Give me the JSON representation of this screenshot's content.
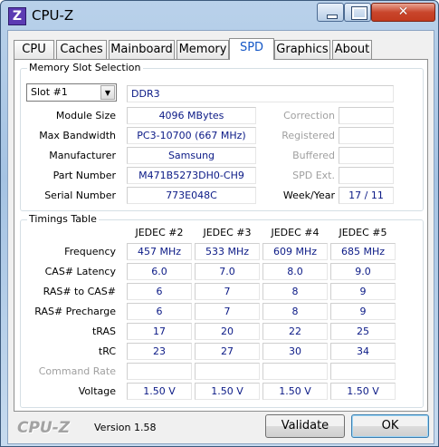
{
  "window": {
    "title": "CPU-Z",
    "app_icon_letter": "Z",
    "close_glyph": "✕"
  },
  "tabs": [
    "CPU",
    "Caches",
    "Mainboard",
    "Memory",
    "SPD",
    "Graphics",
    "About"
  ],
  "active_tab": "SPD",
  "slot_section": {
    "title": "Memory Slot Selection",
    "selected_slot": "Slot #1",
    "memory_type": "DDR3",
    "labels": {
      "module_size": "Module Size",
      "max_bandwidth": "Max Bandwidth",
      "manufacturer": "Manufacturer",
      "part_number": "Part Number",
      "serial_number": "Serial Number",
      "correction": "Correction",
      "registered": "Registered",
      "buffered": "Buffered",
      "spd_ext": "SPD Ext.",
      "week_year": "Week/Year"
    },
    "values": {
      "module_size": "4096 MBytes",
      "max_bandwidth": "PC3-10700 (667 MHz)",
      "manufacturer": "Samsung",
      "part_number": "M471B5273DH0-CH9",
      "serial_number": "773E048C",
      "correction": "",
      "registered": "",
      "buffered": "",
      "spd_ext": "",
      "week_year": "17 / 11"
    }
  },
  "timings": {
    "title": "Timings Table",
    "columns": [
      "JEDEC #2",
      "JEDEC #3",
      "JEDEC #4",
      "JEDEC #5"
    ],
    "rows": [
      {
        "label": "Frequency",
        "values": [
          "457 MHz",
          "533 MHz",
          "609 MHz",
          "685 MHz"
        ]
      },
      {
        "label": "CAS# Latency",
        "values": [
          "6.0",
          "7.0",
          "8.0",
          "9.0"
        ]
      },
      {
        "label": "RAS# to CAS#",
        "values": [
          "6",
          "7",
          "8",
          "9"
        ]
      },
      {
        "label": "RAS# Precharge",
        "values": [
          "6",
          "7",
          "8",
          "9"
        ]
      },
      {
        "label": "tRAS",
        "values": [
          "17",
          "20",
          "22",
          "25"
        ]
      },
      {
        "label": "tRC",
        "values": [
          "23",
          "27",
          "30",
          "34"
        ]
      },
      {
        "label": "Command Rate",
        "values": [
          "",
          "",
          "",
          ""
        ]
      },
      {
        "label": "Voltage",
        "values": [
          "1.50 V",
          "1.50 V",
          "1.50 V",
          "1.50 V"
        ]
      }
    ]
  },
  "footer": {
    "logo": "CPU-Z",
    "version": "Version 1.58",
    "validate_label": "Validate",
    "ok_label": "OK"
  }
}
